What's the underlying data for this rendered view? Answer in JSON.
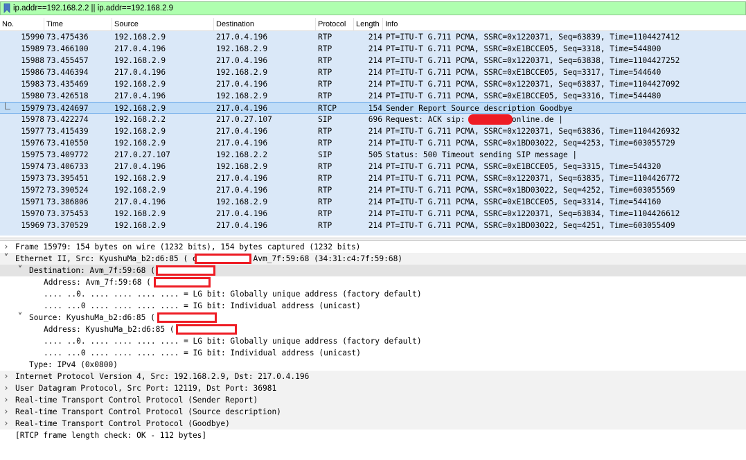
{
  "filter": {
    "expression": "ip.addr==192.168.2.2 || ip.addr==192.168.2.9",
    "bookmark_icon": "bookmark-icon"
  },
  "columns": [
    "No.",
    "Time",
    "Source",
    "Destination",
    "Protocol",
    "Length",
    "Info"
  ],
  "packets": [
    {
      "no": "15990",
      "time": "73.475436",
      "src": "192.168.2.9",
      "dst": "217.0.4.196",
      "proto": "RTP",
      "len": "214",
      "info": "PT=ITU-T G.711 PCMA, SSRC=0x1220371, Seq=63839, Time=1104427412"
    },
    {
      "no": "15989",
      "time": "73.466100",
      "src": "217.0.4.196",
      "dst": "192.168.2.9",
      "proto": "RTP",
      "len": "214",
      "info": "PT=ITU-T G.711 PCMA, SSRC=0xE1BCCE05, Seq=3318, Time=544800"
    },
    {
      "no": "15988",
      "time": "73.455457",
      "src": "192.168.2.9",
      "dst": "217.0.4.196",
      "proto": "RTP",
      "len": "214",
      "info": "PT=ITU-T G.711 PCMA, SSRC=0x1220371, Seq=63838, Time=1104427252"
    },
    {
      "no": "15986",
      "time": "73.446394",
      "src": "217.0.4.196",
      "dst": "192.168.2.9",
      "proto": "RTP",
      "len": "214",
      "info": "PT=ITU-T G.711 PCMA, SSRC=0xE1BCCE05, Seq=3317, Time=544640"
    },
    {
      "no": "15983",
      "time": "73.435469",
      "src": "192.168.2.9",
      "dst": "217.0.4.196",
      "proto": "RTP",
      "len": "214",
      "info": "PT=ITU-T G.711 PCMA, SSRC=0x1220371, Seq=63837, Time=1104427092"
    },
    {
      "no": "15980",
      "time": "73.426518",
      "src": "217.0.4.196",
      "dst": "192.168.2.9",
      "proto": "RTP",
      "len": "214",
      "info": "PT=ITU-T G.711 PCMA, SSRC=0xE1BCCE05, Seq=3316, Time=544480"
    },
    {
      "no": "15979",
      "time": "73.424697",
      "src": "192.168.2.9",
      "dst": "217.0.4.196",
      "proto": "RTCP",
      "len": "154",
      "info": "Sender Report   Source description   Goodbye"
    },
    {
      "no": "15978",
      "time": "73.422274",
      "src": "192.168.2.2",
      "dst": "217.0.27.107",
      "proto": "SIP",
      "len": "696",
      "info": "Request: ACK sip:           87@tel.t-online.de |"
    },
    {
      "no": "15977",
      "time": "73.415439",
      "src": "192.168.2.9",
      "dst": "217.0.4.196",
      "proto": "RTP",
      "len": "214",
      "info": "PT=ITU-T G.711 PCMA, SSRC=0x1220371, Seq=63836, Time=1104426932"
    },
    {
      "no": "15976",
      "time": "73.410550",
      "src": "192.168.2.9",
      "dst": "217.0.4.196",
      "proto": "RTP",
      "len": "214",
      "info": "PT=ITU-T G.711 PCMA, SSRC=0x1BD03022, Seq=4253, Time=603055729"
    },
    {
      "no": "15975",
      "time": "73.409772",
      "src": "217.0.27.107",
      "dst": "192.168.2.2",
      "proto": "SIP",
      "len": "505",
      "info": "Status: 500 Timeout sending SIP message |"
    },
    {
      "no": "15974",
      "time": "73.406733",
      "src": "217.0.4.196",
      "dst": "192.168.2.9",
      "proto": "RTP",
      "len": "214",
      "info": "PT=ITU-T G.711 PCMA, SSRC=0xE1BCCE05, Seq=3315, Time=544320"
    },
    {
      "no": "15973",
      "time": "73.395451",
      "src": "192.168.2.9",
      "dst": "217.0.4.196",
      "proto": "RTP",
      "len": "214",
      "info": "PT=ITU-T G.711 PCMA, SSRC=0x1220371, Seq=63835, Time=1104426772"
    },
    {
      "no": "15972",
      "time": "73.390524",
      "src": "192.168.2.9",
      "dst": "217.0.4.196",
      "proto": "RTP",
      "len": "214",
      "info": "PT=ITU-T G.711 PCMA, SSRC=0x1BD03022, Seq=4252, Time=603055569"
    },
    {
      "no": "15971",
      "time": "73.386806",
      "src": "217.0.4.196",
      "dst": "192.168.2.9",
      "proto": "RTP",
      "len": "214",
      "info": "PT=ITU-T G.711 PCMA, SSRC=0xE1BCCE05, Seq=3314, Time=544160"
    },
    {
      "no": "15970",
      "time": "73.375453",
      "src": "192.168.2.9",
      "dst": "217.0.4.196",
      "proto": "RTP",
      "len": "214",
      "info": "PT=ITU-T G.711 PCMA, SSRC=0x1220371, Seq=63834, Time=1104426612"
    },
    {
      "no": "15969",
      "time": "73.370529",
      "src": "192.168.2.9",
      "dst": "217.0.4.196",
      "proto": "RTP",
      "len": "214",
      "info": "PT=ITU-T G.711 PCMA, SSRC=0x1BD03022, Seq=4251, Time=603055409"
    }
  ],
  "selected_packet_no": "15979",
  "details": [
    {
      "text": "Frame 15979: 154 bytes on wire (1232 bits), 154 bytes captured (1232 bits)",
      "arrow": "collapsed"
    },
    {
      "text": "Ethernet II, Src: KyushuMa_b2:d6:85 (             d6:85), Dst: Avm_7f:59:68 (34:31:c4:7f:59:68)",
      "arrow": "expanded"
    },
    {
      "text": "Destination: Avm_7f:59:68 (             59:68)",
      "arrow": "expanded"
    },
    {
      "text": "Address: Avm_7f:59:68 (             59:68)",
      "arrow": ""
    },
    {
      "text": ".... ..0. .... .... .... .... = LG bit: Globally unique address (factory default)",
      "arrow": ""
    },
    {
      "text": ".... ...0 .... .... .... .... = IG bit: Individual address (unicast)",
      "arrow": ""
    },
    {
      "text": "Source: KyushuMa_b2:d6:85 (             d6:85)",
      "arrow": "expanded"
    },
    {
      "text": "Address: KyushuMa_b2:d6:85 (             d6:85)",
      "arrow": ""
    },
    {
      "text": ".... ..0. .... .... .... .... = LG bit: Globally unique address (factory default)",
      "arrow": ""
    },
    {
      "text": ".... ...0 .... .... .... .... = IG bit: Individual address (unicast)",
      "arrow": ""
    },
    {
      "text": "Type: IPv4 (0x0800)",
      "arrow": ""
    },
    {
      "text": "Internet Protocol Version 4, Src: 192.168.2.9, Dst: 217.0.4.196",
      "arrow": "collapsed"
    },
    {
      "text": "User Datagram Protocol, Src Port: 12119, Dst Port: 36981",
      "arrow": "collapsed"
    },
    {
      "text": "Real-time Transport Control Protocol (Sender Report)",
      "arrow": "collapsed"
    },
    {
      "text": "Real-time Transport Control Protocol (Source description)",
      "arrow": "collapsed"
    },
    {
      "text": "Real-time Transport Control Protocol (Goodbye)",
      "arrow": "collapsed"
    },
    {
      "text": "[RTCP frame length check: OK - 112 bytes]",
      "arrow": ""
    }
  ],
  "colors": {
    "filter_valid": "#afffaf",
    "row_bg": "#dae8f8",
    "selected_bg": "#bfdcf7",
    "redaction": "#ee1c24"
  }
}
